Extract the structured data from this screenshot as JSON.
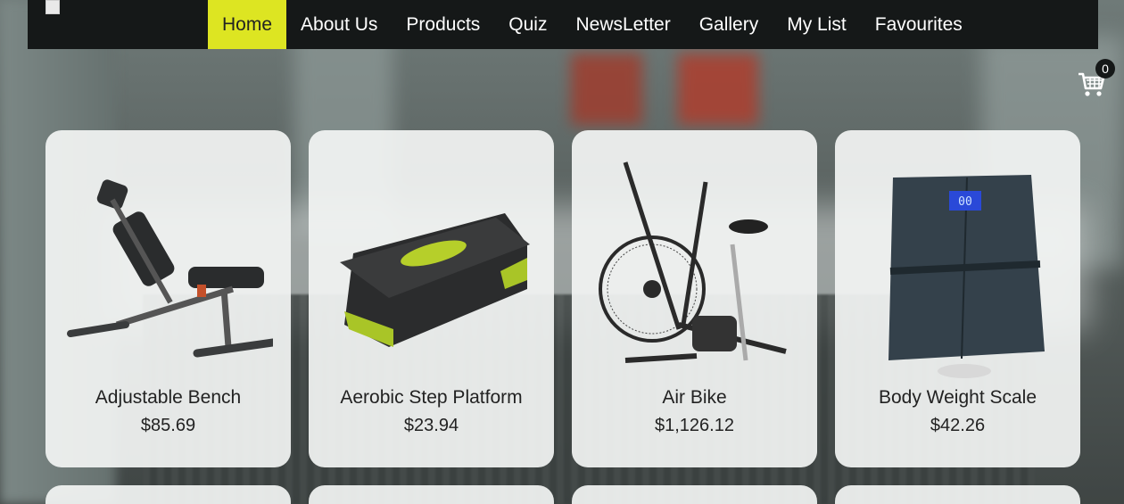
{
  "nav": {
    "items": [
      {
        "label": "Home",
        "active": true
      },
      {
        "label": "About Us"
      },
      {
        "label": "Products"
      },
      {
        "label": "Quiz"
      },
      {
        "label": "NewsLetter"
      },
      {
        "label": "Gallery"
      },
      {
        "label": "My List"
      },
      {
        "label": "Favourites"
      }
    ]
  },
  "cart": {
    "count": "0",
    "icon": "shopping-cart-icon"
  },
  "products": [
    {
      "name": "Adjustable Bench",
      "price": "$85.69",
      "icon": "adjustable-bench-image"
    },
    {
      "name": "Aerobic Step Platform",
      "price": "$23.94",
      "icon": "step-platform-image"
    },
    {
      "name": "Air Bike",
      "price": "$1,126.12",
      "icon": "air-bike-image"
    },
    {
      "name": "Body Weight Scale",
      "price": "$42.26",
      "icon": "weight-scale-image"
    }
  ],
  "colors": {
    "nav_bg": "#151818",
    "accent": "#dde522",
    "card_bg": "#f2f4f3",
    "scale_display": "#2a49d8"
  }
}
